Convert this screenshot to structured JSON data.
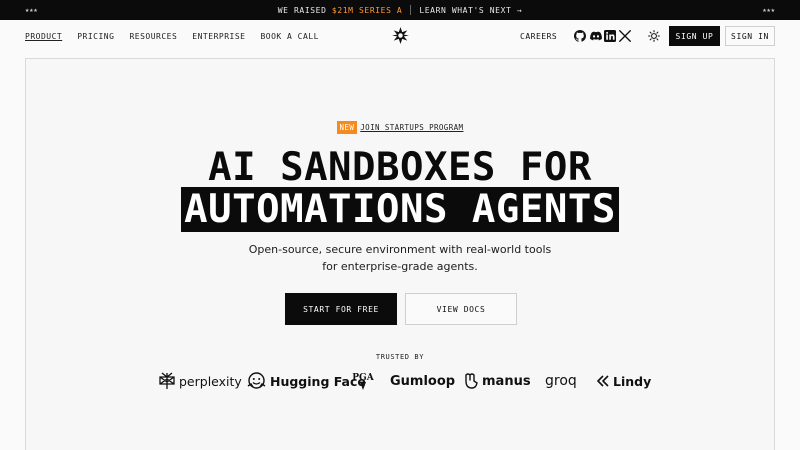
{
  "announcement": {
    "stars_left": "★★★",
    "prefix": "WE RAISED ",
    "highlight": "$21M SERIES A",
    "link": "LEARN WHAT'S NEXT →",
    "stars_right": "★★★",
    "highlight_color": "#ff9a33"
  },
  "nav": {
    "links": [
      "PRODUCT",
      "PRICING",
      "RESOURCES",
      "ENTERPRISE",
      "BOOK A CALL"
    ],
    "careers": "CAREERS",
    "social_icons": [
      "github-icon",
      "discord-icon",
      "linkedin-icon",
      "x-icon"
    ],
    "signup": "SIGN UP",
    "signin": "SIGN IN"
  },
  "hero": {
    "badge": "NEW",
    "badge_link": "JOIN STARTUPS PROGRAM",
    "badge_color": "#f78a1d",
    "title_line1": "AI SANDBOXES FOR",
    "title_line2": "AUTOMATIONS AGENTS",
    "subtitle_line1": "Open-source, secure environment with real-world tools",
    "subtitle_line2": "for enterprise-grade agents.",
    "cta_primary": "START FOR FREE",
    "cta_secondary": "VIEW DOCS"
  },
  "trusted": {
    "label": "TRUSTED BY",
    "brands": [
      "perplexity",
      "Hugging Face",
      "PGA",
      "Gumloop",
      "manus",
      "groq",
      "Lindy"
    ]
  }
}
